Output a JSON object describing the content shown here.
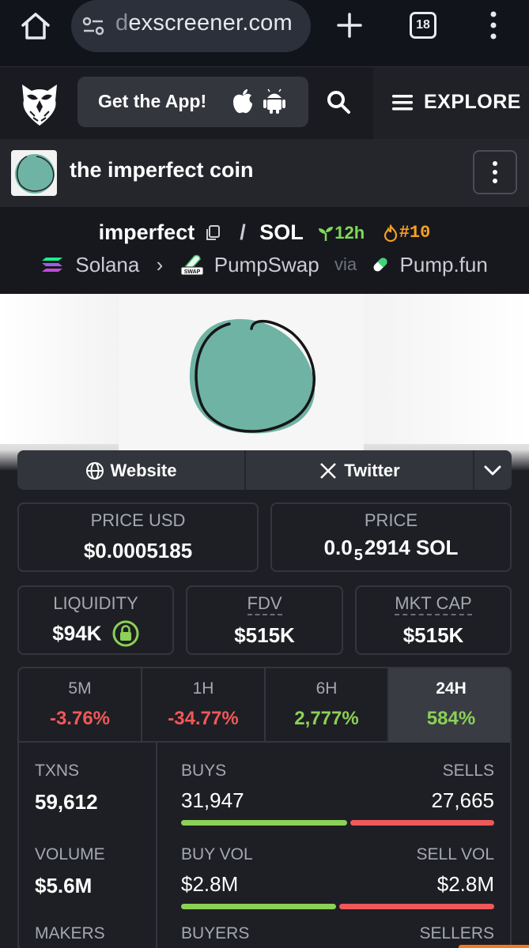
{
  "browser": {
    "url_host": "dexscreener.com",
    "tab_count": "18"
  },
  "header": {
    "get_app_label": "Get the App!",
    "explore_label": "EXPLORE"
  },
  "token": {
    "name": "the imperfect coin"
  },
  "pair": {
    "base": "imperfect",
    "separator": "/",
    "quote": "SOL",
    "age": "12h",
    "rank": "#10",
    "chain": "Solana",
    "dex": "PumpSwap",
    "via_label": "via",
    "launchpad": "Pump.fun"
  },
  "links": {
    "website": "Website",
    "twitter": "Twitter"
  },
  "stats": {
    "price_usd_label": "PRICE USD",
    "price_usd_value": "$0.0005185",
    "price_label": "PRICE",
    "price_value_prefix": "0.0",
    "price_value_sub": "5",
    "price_value_rest": "2914 SOL",
    "liquidity_label": "LIQUIDITY",
    "liquidity_value": "$94K",
    "fdv_label": "FDV",
    "fdv_value": "$515K",
    "mktcap_label": "MKT CAP",
    "mktcap_value": "$515K"
  },
  "timeframes": [
    {
      "label": "5M",
      "value": "-3.76%"
    },
    {
      "label": "1H",
      "value": "-34.77%"
    },
    {
      "label": "6H",
      "value": "2,777%"
    },
    {
      "label": "24H",
      "value": "584%"
    }
  ],
  "txns": {
    "txns_label": "TXNS",
    "txns_value": "59,612",
    "buys_label": "BUYS",
    "buys_value": "31,947",
    "sells_label": "SELLS",
    "sells_value": "27,665",
    "buy_share": 0.536,
    "volume_label": "VOLUME",
    "volume_value": "$5.6M",
    "buy_vol_label": "BUY VOL",
    "buy_vol_value": "$2.8M",
    "sell_vol_label": "SELL VOL",
    "sell_vol_value": "$2.8M",
    "buy_vol_share": 0.5,
    "makers_label": "MAKERS",
    "buyers_label": "BUYERS",
    "sellers_label": "SELLERS"
  },
  "colors": {
    "positive": "#8cd156",
    "negative": "#f0585a",
    "accent_orange": "#f6a023",
    "coin_teal": "#6fb3a5"
  },
  "icons": [
    "home-icon",
    "site-settings-icon",
    "plus-icon",
    "tab-switcher-icon",
    "more-vert-icon",
    "owl-logo",
    "apple-icon",
    "android-icon",
    "search-icon",
    "hamburger-icon",
    "copy-icon",
    "sprout-icon",
    "fire-icon",
    "solana-icon",
    "pumpswap-icon",
    "pill-icon",
    "globe-icon",
    "x-icon",
    "chevron-down-icon",
    "lock-icon"
  ]
}
